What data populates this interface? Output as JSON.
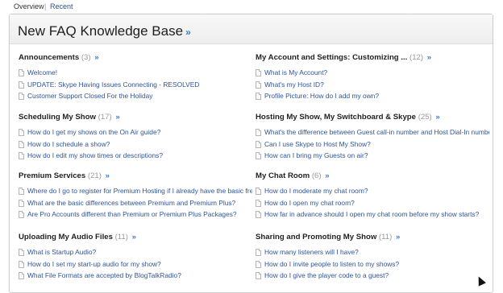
{
  "topnav": {
    "overview": "Overview",
    "separator": "|",
    "recent": "Recent"
  },
  "panel": {
    "title": "New FAQ Knowledge Base",
    "title_arrow": "»"
  },
  "sections": {
    "announcements": {
      "title": "Announcements",
      "count": "(3)",
      "arrow": "»",
      "items": [
        "Welcome!",
        "UPDATE: Skype Having Issues Connecting - RESOLVED",
        "Customer Support Closed For the Holiday"
      ]
    },
    "scheduling": {
      "title": "Scheduling My Show",
      "count": "(17)",
      "arrow": "»",
      "items": [
        "How do I get my shows on the On Air guide?",
        "How do I schedule a show?",
        "How do I edit my show times or descriptions?"
      ]
    },
    "premium": {
      "title": "Premium Services",
      "count": "(21)",
      "arrow": "»",
      "items": [
        "Where do I go to register for Premium Hosting if I already have the basic free",
        "What are the basic differences between Premium and Premium Plus?",
        "Are Pro Accounts different than Premium or Premium Plus Packages?"
      ]
    },
    "uploading": {
      "title": "Uploading My Audio Files",
      "count": "(11)",
      "arrow": "»",
      "items": [
        "What is Startup Audio?",
        "How do I set my start-up audio for my show?",
        "What File Formats are accepted by BlogTalkRadio?"
      ]
    },
    "account": {
      "title": "My Account and Settings: Customizing ...",
      "count": "(12)",
      "arrow": "»",
      "items": [
        "What is My Account?",
        "What's my Host ID?",
        "Profile Picture: How do I add my own?"
      ]
    },
    "hosting": {
      "title": "Hosting My Show, My Switchboard & Skype",
      "count": "(25)",
      "arrow": "»",
      "items": [
        "What's the difference between Guest call-in number and Host Dial-In number",
        "Can I use Skype to Host My Show?",
        "How can I bring my Guests on air?"
      ]
    },
    "chatroom": {
      "title": "My Chat Room",
      "count": "(6)",
      "arrow": "»",
      "items": [
        "How do I moderate my chat room?",
        "How do I open my chat room?",
        "How far in advance should I open my chat room before my show starts?"
      ]
    },
    "sharing": {
      "title": "Sharing and Promoting My Show",
      "count": "(11)",
      "arrow": "»",
      "items": [
        "How many listeners will I have?",
        "How do I invite people to listen to my shows?",
        "How do I give the player code to a guest?"
      ]
    }
  }
}
